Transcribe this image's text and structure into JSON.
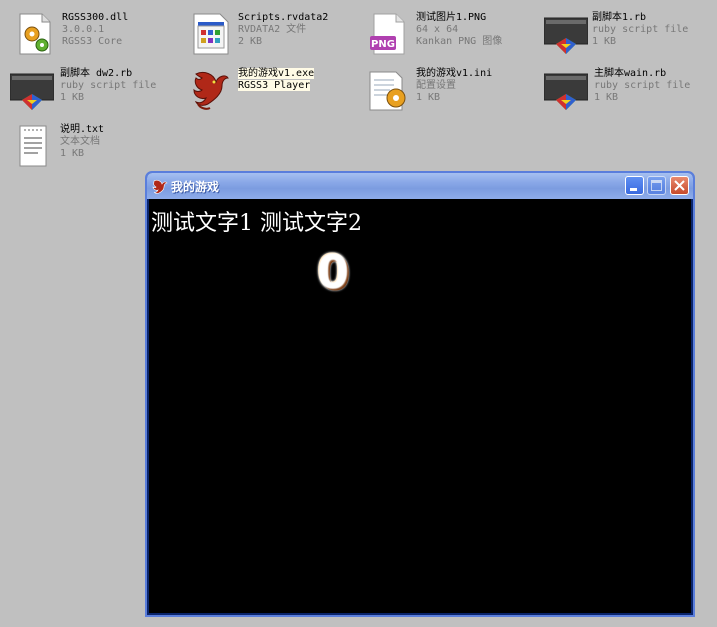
{
  "files": [
    {
      "name": "RGSS300.dll",
      "line2": "3.0.0.1",
      "line3": "RGSS3 Core",
      "icon": "dll-gear-icon"
    },
    {
      "name": "Scripts.rvdata2",
      "line2": "RVDATA2 文件",
      "line3": "2 KB",
      "icon": "application-window-icon"
    },
    {
      "name": "测试图片1.PNG",
      "line2": "64 x 64",
      "line3": "Kankan PNG 图像",
      "icon": "png-file-icon"
    },
    {
      "name": "副脚本1.rb",
      "line2": "ruby script file",
      "line3": "1 KB",
      "icon": "ruby-script-icon"
    },
    {
      "name": "副脚本 dw2.rb",
      "line2": "ruby script file",
      "line3": "1 KB",
      "icon": "ruby-script-icon"
    },
    {
      "name": "我的游戏v1.exe",
      "line2": "RGSS3 Player",
      "line3": "",
      "icon": "dragon-exe-icon"
    },
    {
      "name": "我的游戏v1.ini",
      "line2": "配置设置",
      "line3": "1 KB",
      "icon": "ini-settings-icon"
    },
    {
      "name": "主脚本wain.rb",
      "line2": "ruby script file",
      "line3": "1 KB",
      "icon": "ruby-script-icon"
    },
    {
      "name": "说明.txt",
      "line2": "文本文档",
      "line3": "1 KB",
      "icon": "text-document-icon"
    }
  ],
  "window": {
    "title": "我的游戏",
    "game_text": "测试文字1 测试文字2",
    "score": "0"
  },
  "colors": {
    "desktop": "#c0c0c0",
    "titlebar": "#7c9ce0",
    "client": "#000000"
  }
}
